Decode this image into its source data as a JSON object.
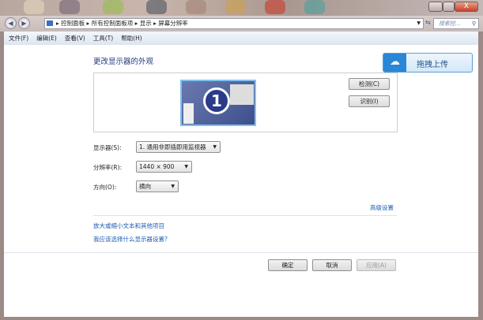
{
  "window": {
    "minimize": "–",
    "maximize": "□",
    "close": "X"
  },
  "address": {
    "crumbs": [
      "控制面板",
      "所有控制面板项",
      "显示",
      "屏幕分辨率"
    ],
    "search_placeholder": "搜索控..."
  },
  "menu": [
    "文件(F)",
    "编辑(E)",
    "查看(V)",
    "工具(T)",
    "帮助(H)"
  ],
  "main": {
    "title": "更改显示器的外观",
    "monitor_number": "1",
    "detect": "检测(C)",
    "identify": "识别(I)",
    "display_label": "显示器(S):",
    "display_value": "1. 通用非即插即用监视器",
    "resolution_label": "分辨率(R):",
    "resolution_value": "1440 × 900",
    "orientation_label": "方向(O):",
    "orientation_value": "横向",
    "advanced": "高级设置",
    "link1": "放大或缩小文本和其他项目",
    "link2": "我应该选择什么显示器设置?",
    "ok": "确定",
    "cancel": "取消",
    "apply": "应用(A)"
  },
  "overlay": {
    "upload_label": "拖拽上传",
    "icon": "cloud-upload-icon"
  }
}
